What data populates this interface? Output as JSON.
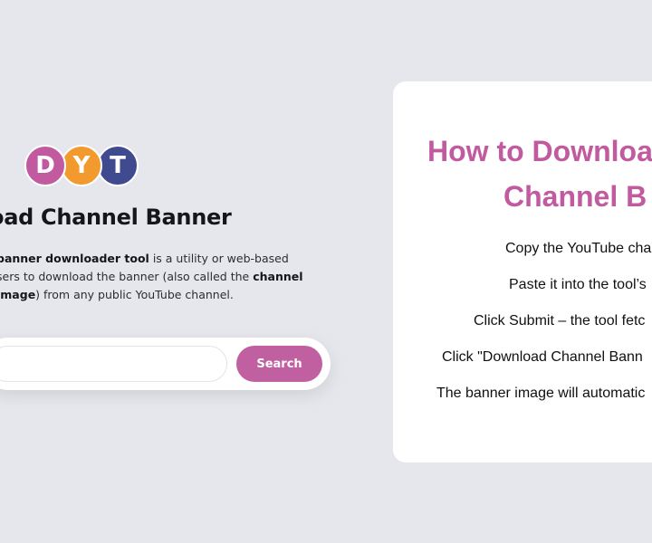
{
  "hero": {
    "logo_letters": [
      "D",
      "Y",
      "T"
    ],
    "logo_colors": [
      "#c25a9f",
      "#f29a2e",
      "#3f4a8f"
    ],
    "title": "oad Channel Banner",
    "description_lines": [
      {
        "pre": "",
        "bold": "banner downloader tool",
        "post": " is a utility or web-based"
      },
      {
        "pre": "sers to download the banner (also called the ",
        "bold": "channel",
        "post": ""
      },
      {
        "pre": "",
        "bold": "image",
        "post": ") from any public YouTube channel."
      }
    ]
  },
  "search": {
    "value": "",
    "placeholder": "",
    "button_label": "Search",
    "accent_color": "#c060a0"
  },
  "card": {
    "title_line1": "How to Downloa",
    "title_line2": "Channel B",
    "title_color": "#c25a9f",
    "steps": [
      "Copy the YouTube cha",
      "Paste it into the tool’s",
      "Click Submit – the tool fetc",
      "Click \"Download Channel Bann",
      "The banner image will automatic"
    ]
  }
}
